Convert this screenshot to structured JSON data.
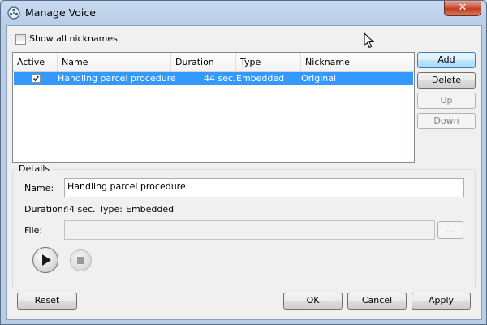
{
  "window": {
    "title": "Manage Voice",
    "close_glyph": "✕"
  },
  "show_all": {
    "label": "Show all nicknames",
    "checked": false
  },
  "list": {
    "columns": [
      "Active",
      "Name",
      "Duration",
      "Type",
      "Nickname"
    ],
    "rows": [
      {
        "active": true,
        "name": "Handling parcel procedure",
        "duration": "44 sec.",
        "type": "Embedded",
        "nickname": "Original",
        "selected": true
      }
    ]
  },
  "side_buttons": {
    "add": "Add",
    "delete": "Delete",
    "up": "Up",
    "down": "Down"
  },
  "details": {
    "group_label": "Details",
    "name_label": "Name:",
    "name_value": "Handling parcel procedure",
    "duration_label": "Duration:",
    "duration_value": "44 sec.",
    "type_label": "Type:",
    "type_value": "Embedded",
    "file_label": "File:",
    "file_value": "",
    "browse_label": "..."
  },
  "media": {
    "play_icon": "play-icon",
    "stop_icon": "stop-icon"
  },
  "footer": {
    "reset": "Reset",
    "ok": "OK",
    "cancel": "Cancel",
    "apply": "Apply"
  }
}
